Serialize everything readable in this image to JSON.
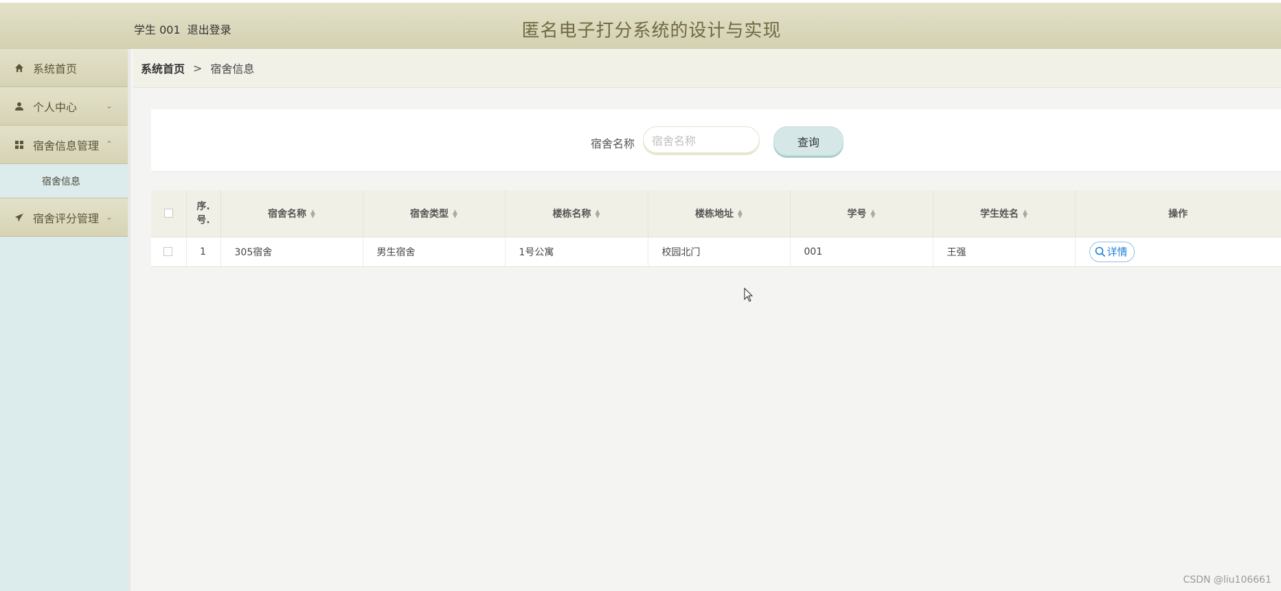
{
  "header": {
    "user_label": "学生 001",
    "logout_label": "退出登录",
    "title": "匿名电子打分系统的设计与实现"
  },
  "sidebar": {
    "items": [
      {
        "label": "系统首页",
        "icon": "home-icon"
      },
      {
        "label": "个人中心",
        "icon": "user-icon",
        "chevron": "⌄"
      },
      {
        "label": "宿舍信息管理",
        "icon": "grid-icon",
        "chevron": "⌃"
      },
      {
        "label": "宿舍评分管理",
        "icon": "paper-plane-icon",
        "chevron": "⌄"
      }
    ],
    "submenu": {
      "label": "宿舍信息"
    }
  },
  "breadcrumb": {
    "home": "系统首页",
    "separator": ">",
    "current": "宿舍信息"
  },
  "search": {
    "label": "宿舍名称",
    "placeholder": "宿舍名称",
    "value": "",
    "button": "查询"
  },
  "table": {
    "headers": {
      "index": "序.号.",
      "dorm_name": "宿舍名称",
      "dorm_type": "宿舍类型",
      "building_name": "楼栋名称",
      "building_address": "楼栋地址",
      "student_id": "学号",
      "student_name": "学生姓名",
      "actions": "操作"
    },
    "rows": [
      {
        "index": "1",
        "dorm_name": "305宿舍",
        "dorm_type": "男生宿舍",
        "building_name": "1号公寓",
        "building_address": "校园北门",
        "student_id": "001",
        "student_name": "王强",
        "action_label": "详情"
      }
    ]
  },
  "watermark": "CSDN @liu106661",
  "colors": {
    "header_bg": "#dcd9bd",
    "title_color": "#6e6a42",
    "sidebar_bg": "#dcebeb",
    "accent_blue": "#1e7fd6"
  }
}
